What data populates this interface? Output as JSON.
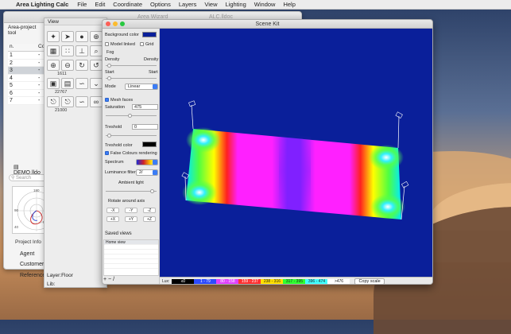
{
  "menubar": {
    "apple": "",
    "app_name": "Area Lighting Calc",
    "items": [
      "File",
      "Edit",
      "Coordinate",
      "Options",
      "Layers",
      "View",
      "Lighting",
      "Window",
      "Help"
    ]
  },
  "bg_window": {
    "title_a": "Area Wizard",
    "title_b": "ALC.lldoc",
    "header": "Area-project tool",
    "col_n": "n.",
    "col_c": "Co",
    "rows": [
      "1",
      "2",
      "3",
      "4",
      "5",
      "6",
      "7"
    ],
    "row_marks": [
      "-",
      "-",
      "-",
      "-",
      "-",
      "-",
      "-"
    ],
    "selected_row": "3",
    "search_placeholder": "Search",
    "file_name": "DEMO.lldo",
    "project_info": "Project Info",
    "buttons": [
      "Agent",
      "Customer",
      "Reference"
    ],
    "polar_labels": [
      "180",
      "120",
      "90",
      "60",
      "40"
    ]
  },
  "view_window": {
    "title": "View",
    "num_a": "1611",
    "num_b": "22767",
    "num_c": "21000",
    "layer": "Layer:Floor",
    "lib": "Lib:"
  },
  "scene": {
    "title": "Scene Kit",
    "background_color_label": "Background color",
    "background_color": "#0a1f9a",
    "model_linked": "Model linked",
    "grid": "Grid",
    "fog": "Fog",
    "density_left": "Density",
    "density_right": "Density",
    "start_left": "Start",
    "start_right": "Start",
    "mode_label": "Mode",
    "mode_value": "Linear",
    "mesh_faces": "Mesh faces",
    "saturation_label": "Saturation",
    "saturation_value": "475",
    "treshold_label": "Treshold",
    "treshold_value": "0",
    "treshold_color_label": "Treshold color",
    "treshold_color": "#000000",
    "false_colours": "False Colours rendering",
    "spectrum_label": "Spectrum",
    "luminance_filter_label": "Luminance filter",
    "luminance_filter_value": "2/",
    "ambient_light": "Ambient light",
    "rotate_label": "Rotate around axis",
    "rotate_buttons": [
      "-X",
      "-Y",
      "-Z",
      "+X",
      "+Y",
      "+Z"
    ],
    "saved_views": "Saved views",
    "home_view": "Home view",
    "saved_controls": "+ − /",
    "lux_label": "Lux:",
    "scale_cells": [
      "≤0",
      "1 - 79",
      "80 - 158",
      "159 - 237",
      "238 - 316",
      "317 - 395",
      "396 - 474",
      ">476"
    ],
    "scale_colors": [
      "#000000",
      "#2d4bff",
      "#e040ff",
      "#ff3030",
      "#ffe000",
      "#30ff30",
      "#40ffff",
      "#ffffff"
    ],
    "copy_scale": "Copy scale"
  }
}
